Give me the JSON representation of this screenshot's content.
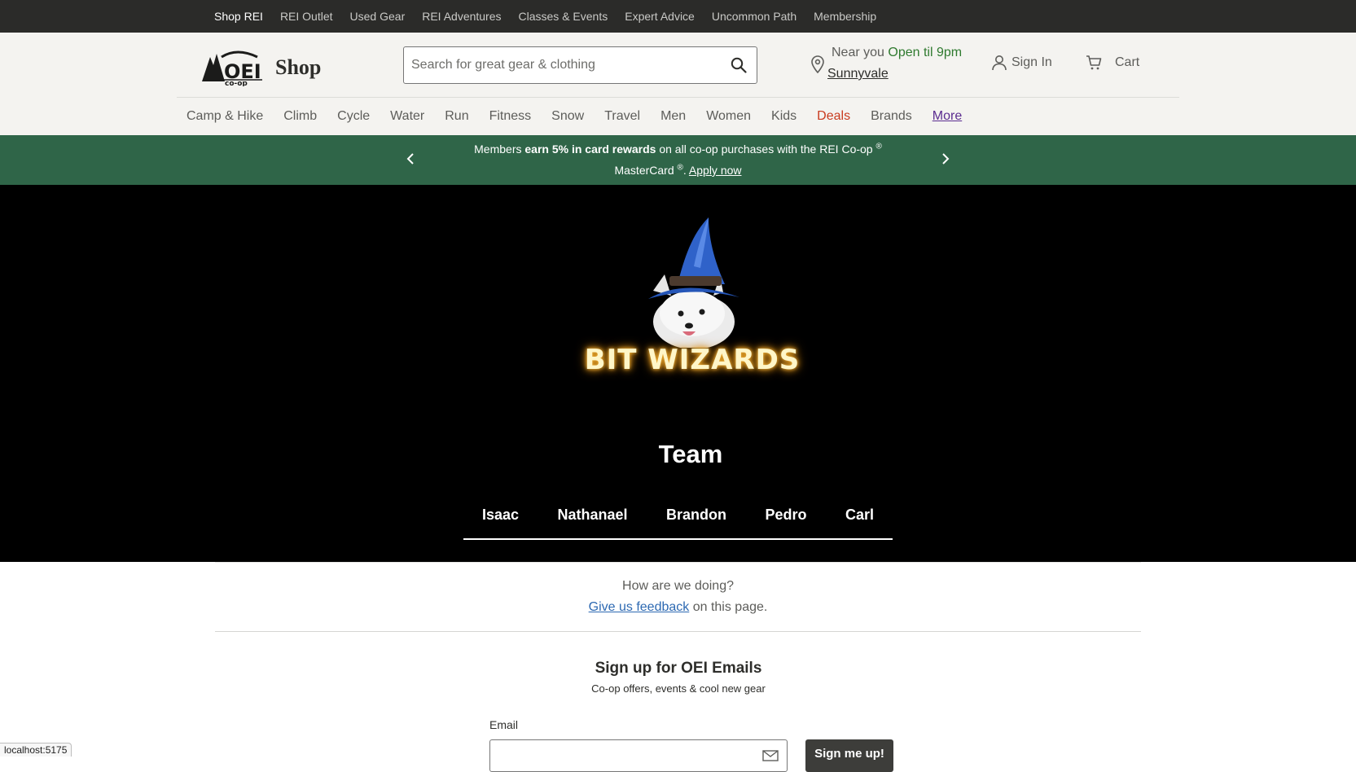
{
  "topbar": {
    "items": [
      {
        "label": "Shop REI",
        "active": true
      },
      {
        "label": "REI Outlet"
      },
      {
        "label": "Used Gear"
      },
      {
        "label": "REI Adventures"
      },
      {
        "label": "Classes & Events"
      },
      {
        "label": "Expert Advice"
      },
      {
        "label": "Uncommon Path"
      },
      {
        "label": "Membership"
      }
    ]
  },
  "header": {
    "logo_text": "OEI co-op",
    "shop_label": "Shop",
    "search": {
      "placeholder": "Search for great gear & clothing",
      "value": "",
      "icon": "search-icon"
    },
    "store": {
      "near_label": "Near you",
      "hours": "Open til 9pm",
      "city": "Sunnyvale",
      "icon": "pin-icon"
    },
    "signin_label": "Sign In",
    "cart_label": "Cart"
  },
  "catnav": {
    "items": [
      "Camp & Hike",
      "Climb",
      "Cycle",
      "Water",
      "Run",
      "Fitness",
      "Snow",
      "Travel",
      "Men",
      "Women",
      "Kids",
      "Deals",
      "Brands",
      "More"
    ]
  },
  "promo": {
    "prefix": "Members ",
    "bold": "earn 5% in card rewards",
    "middle": " on all co-op purchases with the REI Co-op",
    "reg1": "®",
    "line2": " MasterCard",
    "reg2": "®",
    "period": ". ",
    "apply": "Apply now"
  },
  "hero": {
    "brand_title": "BIT WIZARDS",
    "team_title": "Team",
    "team_tabs": [
      "Isaac",
      "Nathanael",
      "Brandon",
      "Pedro",
      "Carl"
    ]
  },
  "feedback": {
    "question": "How are we doing?",
    "link": "Give us feedback",
    "suffix": " on this page."
  },
  "signup": {
    "title": "Sign up for OEI Emails",
    "subtitle": "Co-op offers, events & cool new gear",
    "email_label": "Email",
    "button": "Sign me up!"
  },
  "status_url": "localhost:5175",
  "colors": {
    "topbar": "#2b2b29",
    "header": "#f4f3f0",
    "promo": "#2f6548",
    "deals": "#c93b1f",
    "more": "#5b2c90",
    "link": "#2d69b2",
    "hours": "#2f7a2f"
  }
}
